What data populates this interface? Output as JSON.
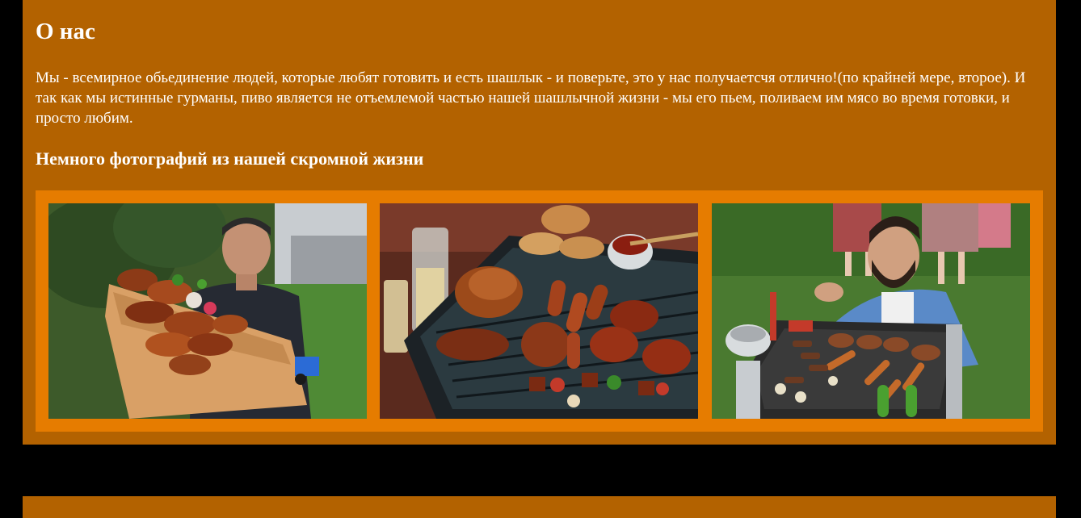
{
  "about": {
    "title": "О нас",
    "text": "Мы - всемирное обьединение людей, которые любят готовить и есть шашлык - и поверьте, это у нас получаетсчя отлично!(по крайней мере, второе). И так как мы истинные гурманы, пиво является не отъемлемой частью нашей шашлычной жизни - мы его пьем, поливаем им мясо во время готовки, и просто любим.",
    "gallery_title": "Немного фотографий из нашей скромной жизни"
  },
  "gallery": {
    "photos": [
      {
        "name": "man-holding-grilled-chicken-board-photo"
      },
      {
        "name": "grill-with-meat-and-sausages-photo"
      },
      {
        "name": "bearded-man-grilling-outdoors-photo"
      }
    ]
  },
  "colors": {
    "page_background": "#000000",
    "section_background": "#b36200",
    "gallery_frame": "#e67c00",
    "text": "#ffffff"
  }
}
